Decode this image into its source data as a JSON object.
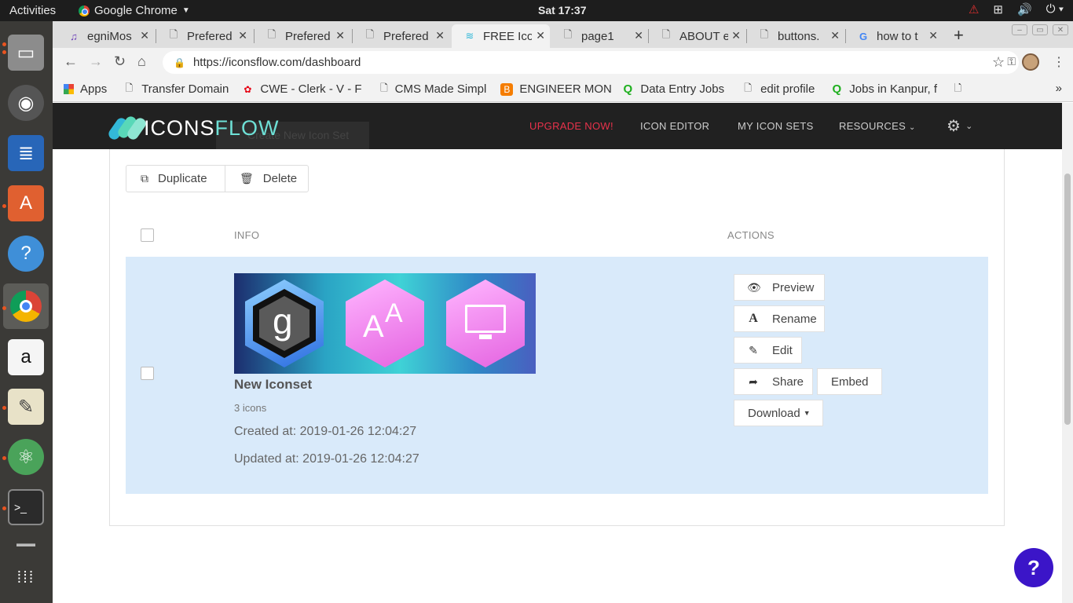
{
  "topbar": {
    "activities": "Activities",
    "app_name": "Google Chrome",
    "clock": "Sat 17:37"
  },
  "tabs": [
    {
      "title": "egniMos",
      "icon": "app-icon"
    },
    {
      "title": "Prefered",
      "icon": "page-icon"
    },
    {
      "title": "Prefered",
      "icon": "page-icon"
    },
    {
      "title": "Prefered",
      "icon": "page-icon"
    },
    {
      "title": "FREE Ico",
      "icon": "iconsflow-icon"
    },
    {
      "title": "page1",
      "icon": "page-icon"
    },
    {
      "title": "ABOUT e",
      "icon": "page-icon"
    },
    {
      "title": "buttons.",
      "icon": "page-icon"
    },
    {
      "title": "how to t",
      "icon": "google-icon"
    }
  ],
  "address": {
    "url": "https://iconsflow.com/dashboard"
  },
  "bookmarks": [
    {
      "label": "Apps",
      "icon": "apps-grid-icon"
    },
    {
      "label": "Transfer Domain",
      "icon": "page-icon"
    },
    {
      "label": "CWE - Clerk - V - F",
      "icon": "huawei-icon"
    },
    {
      "label": "CMS Made Simpl",
      "icon": "page-icon"
    },
    {
      "label": "ENGINEER MON",
      "icon": "blogger-icon"
    },
    {
      "label": "Data Entry Jobs",
      "icon": "q-icon"
    },
    {
      "label": "edit profile",
      "icon": "page-icon"
    },
    {
      "label": "Jobs in Kanpur, f",
      "icon": "q-icon"
    }
  ],
  "site": {
    "logo_a": "ICONS",
    "logo_b": "FLOW",
    "nav": {
      "upgrade": "UPGRADE NOW!",
      "editor": "ICON EDITOR",
      "sets": "MY ICON SETS",
      "resources": "RESOURCES"
    },
    "ghost_button": "Create New Icon Set",
    "colors": {
      "navbar": "#212121",
      "upgrade": "#e8324b",
      "row_bg": "#d9eafa",
      "help": "#3b15c8"
    }
  },
  "toolbar": {
    "duplicate": "Duplicate",
    "delete": "Delete"
  },
  "table": {
    "col_info": "INFO",
    "col_actions": "ACTIONS",
    "row": {
      "name": "New Iconset",
      "count": "3 icons",
      "created": "Created at: 2019-01-26 12:04:27",
      "updated": "Updated at: 2019-01-26 12:04:27",
      "thumb_letters": {
        "a": "g",
        "b": "A",
        "c": "A"
      }
    }
  },
  "actions": {
    "preview": "Preview",
    "rename": "Rename",
    "edit": "Edit",
    "share": "Share",
    "embed": "Embed",
    "download": "Download"
  },
  "help": "?"
}
